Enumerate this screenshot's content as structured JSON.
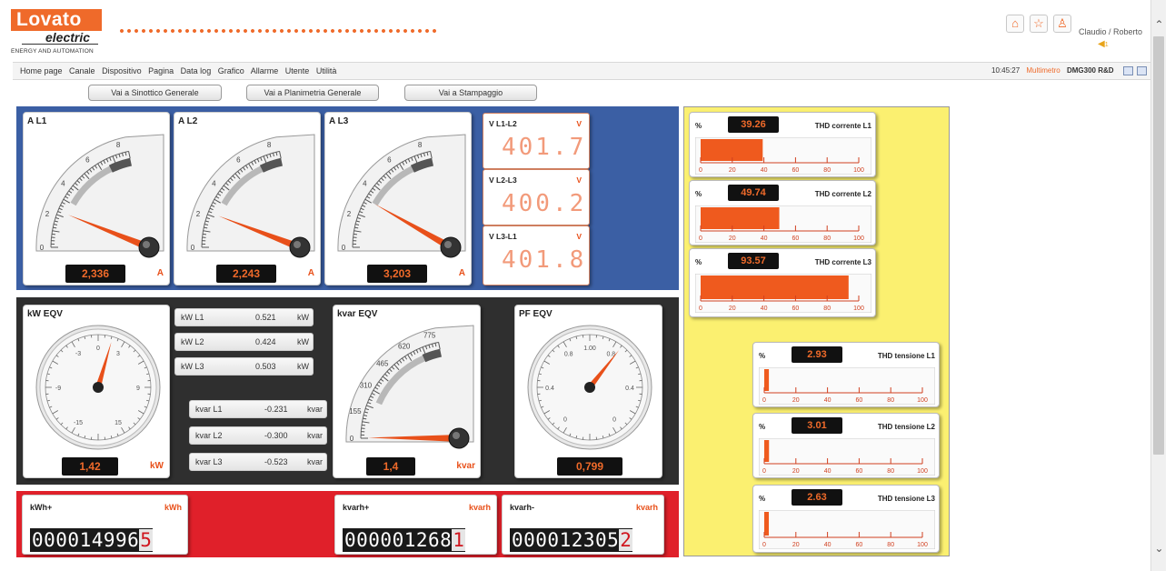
{
  "brand": {
    "name": "Lovato",
    "sub": "electric",
    "tagline": "ENERGY AND AUTOMATION"
  },
  "header": {
    "user": "Claudio / Roberto",
    "notifications": "1",
    "icons": [
      "home-icon",
      "star-icon",
      "user-icon"
    ]
  },
  "menu": [
    "Home page",
    "Canale",
    "Dispositivo",
    "Pagina",
    "Data log",
    "Grafico",
    "Allarme",
    "Utente",
    "Utilità"
  ],
  "status": {
    "time": "10:45:27",
    "mode": "Multimetro",
    "device": "DMG300 R&D"
  },
  "nav_buttons": [
    "Vai a Sinottico Generale",
    "Vai a Planimetria Generale",
    "Vai a Stampaggio"
  ],
  "current_gauges": [
    {
      "title": "A L1",
      "value": "2,336",
      "unit": "A",
      "fraction": 0.28,
      "ticks": [
        "0",
        "2",
        "4",
        "6",
        "8"
      ]
    },
    {
      "title": "A L2",
      "value": "2,243",
      "unit": "A",
      "fraction": 0.27,
      "ticks": [
        "0",
        "2",
        "4",
        "6",
        "8"
      ]
    },
    {
      "title": "A L3",
      "value": "3,203",
      "unit": "A",
      "fraction": 0.38,
      "ticks": [
        "0",
        "2",
        "4",
        "6",
        "8"
      ]
    }
  ],
  "voltages": [
    {
      "title": "V L1-L2",
      "value": "401.7",
      "unit": "V"
    },
    {
      "title": "V L2-L3",
      "value": "400.2",
      "unit": "V"
    },
    {
      "title": "V L3-L1",
      "value": "401.8",
      "unit": "V"
    }
  ],
  "kw": {
    "title": "kW EQV",
    "value": "1,42",
    "unit": "kW",
    "ticks": [
      "0",
      "3",
      "9",
      "15",
      "-15",
      "-9",
      "-3"
    ],
    "reading": 1.42
  },
  "kw_rows": [
    {
      "label": "kW L1",
      "value": "0.521",
      "unit": "kW"
    },
    {
      "label": "kW L2",
      "value": "0.424",
      "unit": "kW"
    },
    {
      "label": "kW L3",
      "value": "0.503",
      "unit": "kW"
    }
  ],
  "kvar_rows": [
    {
      "label": "kvar L1",
      "value": "-0.231",
      "unit": "kvar"
    },
    {
      "label": "kvar L2",
      "value": "-0.300",
      "unit": "kvar"
    },
    {
      "label": "kvar L3",
      "value": "-0.523",
      "unit": "kvar"
    }
  ],
  "kvar": {
    "title": "kvar EQV",
    "value": "1,4",
    "unit": "kvar",
    "ticks": [
      "0",
      "155",
      "310",
      "465",
      "620",
      "775"
    ],
    "fraction": 0.005
  },
  "pf": {
    "title": "PF EQV",
    "value": "0,799",
    "ticks": [
      "1.00",
      "0.8",
      "0.8",
      "0.4",
      "0.4",
      "0",
      "0"
    ],
    "reading": 0.799
  },
  "counters": [
    {
      "title": "kWh+",
      "unit": "kWh",
      "digits": "000014996",
      "last": "5"
    },
    {
      "title": "kvarh+",
      "unit": "kvarh",
      "digits": "000001268",
      "last": "1"
    },
    {
      "title": "kvarh-",
      "unit": "kvarh",
      "digits": "000012305",
      "last": "2"
    }
  ],
  "thd": [
    {
      "label": "THD corrente L1",
      "value": "39.26",
      "pct": 39.26
    },
    {
      "label": "THD corrente L2",
      "value": "49.74",
      "pct": 49.74
    },
    {
      "label": "THD corrente L3",
      "value": "93.57",
      "pct": 93.57
    },
    {
      "label": "THD tensione L1",
      "value": "2.93",
      "pct": 2.93
    },
    {
      "label": "THD tensione L2",
      "value": "3.01",
      "pct": 3.01
    },
    {
      "label": "THD tensione L3",
      "value": "2.63",
      "pct": 2.63
    }
  ],
  "thd_axis": [
    "0",
    "20",
    "40",
    "60",
    "80",
    "100"
  ],
  "thd_pct_symbol": "%",
  "colors": {
    "accent": "#ef6a2a",
    "blue_panel": "#3b5fa4",
    "red_panel": "#e0202a",
    "yellow_panel": "#fbf070",
    "dark_panel": "#2f2f2f"
  }
}
